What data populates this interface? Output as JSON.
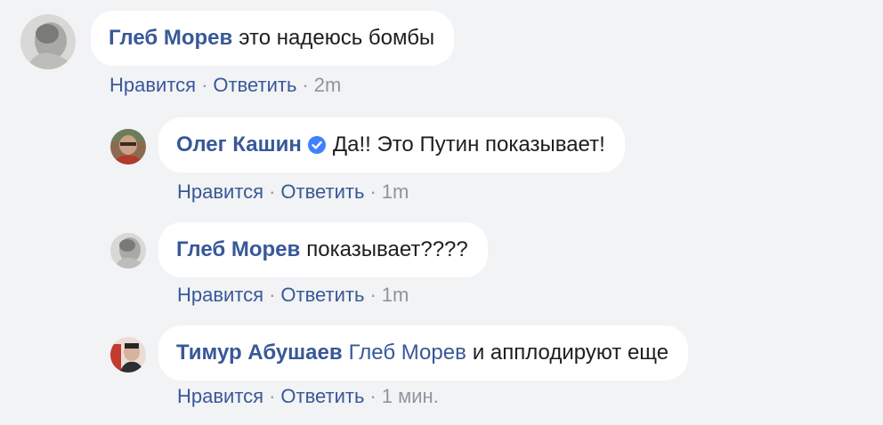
{
  "comments": [
    {
      "author": "Глеб Морев",
      "text": "это надеюсь бомбы",
      "like": "Нравится",
      "reply": "Ответить",
      "time": "2m",
      "avatar_icon": "person-photo-icon"
    },
    {
      "author": "Олег Кашин",
      "verified": true,
      "text": "Да!! Это Путин показывает!",
      "like": "Нравится",
      "reply": "Ответить",
      "time": "1m",
      "avatar_icon": "person-photo-icon"
    },
    {
      "author": "Глеб Морев",
      "text": "показывает????",
      "like": "Нравится",
      "reply": "Ответить",
      "time": "1m",
      "avatar_icon": "person-photo-icon"
    },
    {
      "author": "Тимур Абушаев",
      "mention": "Глеб Морев",
      "text": "и апплодируют еще",
      "like": "Нравится",
      "reply": "Ответить",
      "time": "1 мин.",
      "avatar_icon": "person-photo-icon"
    }
  ],
  "colors": {
    "background": "#f2f3f5",
    "bubble": "#ffffff",
    "link": "#385898",
    "text": "#1c1e21",
    "meta": "#90949c",
    "verified_badge": "#4080ff"
  }
}
